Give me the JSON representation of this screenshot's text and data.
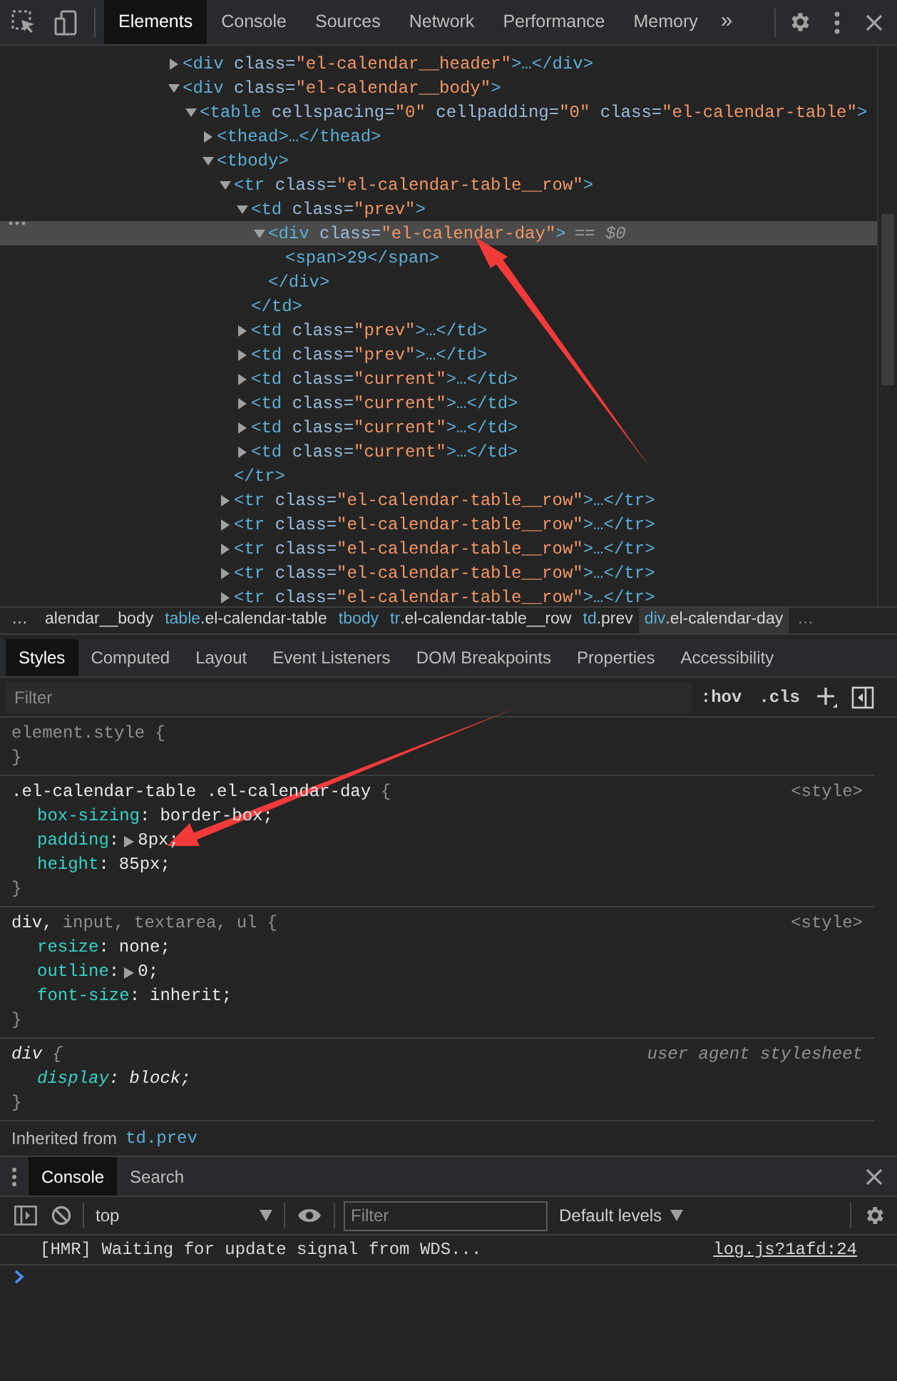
{
  "main_tabs": [
    {
      "label": "Elements",
      "selected": true
    },
    {
      "label": "Console",
      "selected": false
    },
    {
      "label": "Sources",
      "selected": false
    },
    {
      "label": "Network",
      "selected": false
    },
    {
      "label": "Performance",
      "selected": false
    },
    {
      "label": "Memory",
      "selected": false
    }
  ],
  "more_tabs": "»",
  "dom_tree": [
    {
      "tag": "<div class=\"el-calendar__header\">…</div>",
      "expanded": false,
      "selected": false
    },
    {
      "tag": "<div class=\"el-calendar__body\">",
      "expanded": true,
      "selected": false,
      "children": [
        {
          "tag": "<table cellspacing=\"0\" cellpadding=\"0\" class=\"el-calendar-table\">",
          "expanded": true,
          "selected": false,
          "children": [
            {
              "tag": "<thead>…</thead>",
              "expanded": false,
              "selected": false
            },
            {
              "tag": "<tbody>",
              "expanded": true,
              "selected": false,
              "children": [
                {
                  "tag": "<tr class=\"el-calendar-table__row\">",
                  "expanded": true,
                  "selected": false,
                  "close": "</tr>",
                  "children": [
                    {
                      "tag": "<td class=\"prev\">",
                      "expanded": true,
                      "selected": false,
                      "close": "</td>",
                      "children": [
                        {
                          "tag": "<div class=\"el-calendar-day\">",
                          "expanded": true,
                          "selected": true,
                          "suffix": "== $0",
                          "close": "</div>",
                          "children": [
                            {
                              "tag": "<span>29</span>",
                              "selected": false
                            }
                          ]
                        }
                      ]
                    },
                    {
                      "tag": "<td class=\"prev\">…</td>",
                      "expanded": false,
                      "selected": false
                    },
                    {
                      "tag": "<td class=\"prev\">…</td>",
                      "expanded": false,
                      "selected": false
                    },
                    {
                      "tag": "<td class=\"current\">…</td>",
                      "expanded": false,
                      "selected": false
                    },
                    {
                      "tag": "<td class=\"current\">…</td>",
                      "expanded": false,
                      "selected": false
                    },
                    {
                      "tag": "<td class=\"current\">…</td>",
                      "expanded": false,
                      "selected": false
                    },
                    {
                      "tag": "<td class=\"current\">…</td>",
                      "expanded": false,
                      "selected": false
                    }
                  ]
                },
                {
                  "tag": "<tr class=\"el-calendar-table__row\">…</tr>",
                  "expanded": false,
                  "selected": false
                },
                {
                  "tag": "<tr class=\"el-calendar-table__row\">…</tr>",
                  "expanded": false,
                  "selected": false
                },
                {
                  "tag": "<tr class=\"el-calendar-table__row\">…</tr>",
                  "expanded": false,
                  "selected": false
                },
                {
                  "tag": "<tr class=\"el-calendar-table__row\">…</tr>",
                  "expanded": false,
                  "selected": false
                },
                {
                  "tag": "<tr class=\"el-calendar-table__row\">…</tr>",
                  "expanded": false,
                  "selected": false
                }
              ]
            }
          ]
        }
      ]
    }
  ],
  "breadcrumbs": {
    "more": "…",
    "items": [
      {
        "cls": "alendar__body",
        "selected": false
      },
      {
        "tag": "table",
        "cls": ".el-calendar-table",
        "selected": false
      },
      {
        "tag": "tbody",
        "selected": false
      },
      {
        "tag": "tr",
        "cls": ".el-calendar-table__row",
        "selected": false
      },
      {
        "tag": "td",
        "cls": ".prev",
        "selected": false
      },
      {
        "tag": "div",
        "cls": ".el-calendar-day",
        "selected": true
      }
    ]
  },
  "sidebar_tabs": [
    {
      "label": "Styles",
      "selected": true
    },
    {
      "label": "Computed",
      "selected": false
    },
    {
      "label": "Layout",
      "selected": false
    },
    {
      "label": "Event Listeners",
      "selected": false
    },
    {
      "label": "DOM Breakpoints",
      "selected": false
    },
    {
      "label": "Properties",
      "selected": false
    },
    {
      "label": "Accessibility",
      "selected": false
    }
  ],
  "styles_filter": {
    "placeholder": "Filter",
    "hov": ":hov",
    "cls": ".cls"
  },
  "rules": [
    {
      "kind": "inline",
      "selector": [
        {
          "text": "element.style",
          "matched": false
        }
      ],
      "open": "{",
      "close": "}"
    },
    {
      "kind": "author",
      "source": "<style>",
      "selector": [
        {
          "text": ".el-calendar-table .el-calendar-day",
          "matched": true
        }
      ],
      "open": "{",
      "close": "}",
      "declarations": [
        {
          "name": "box-sizing",
          "colon": ":",
          "value": "border-box;",
          "expandable": false
        },
        {
          "name": "padding",
          "colon": ":",
          "value": "8px;",
          "expandable": true
        },
        {
          "name": "height",
          "colon": ":",
          "value": "85px;",
          "expandable": false
        }
      ]
    },
    {
      "kind": "author",
      "source": "<style>",
      "selector": [
        {
          "text": "div,",
          "matched": true
        },
        {
          "text": "input,",
          "matched": false
        },
        {
          "text": "textarea,",
          "matched": false
        },
        {
          "text": "ul",
          "matched": false
        }
      ],
      "open": "{",
      "close": "}",
      "declarations": [
        {
          "name": "resize",
          "colon": ":",
          "value": "none;",
          "expandable": false
        },
        {
          "name": "outline",
          "colon": ":",
          "value": "0;",
          "expandable": true
        },
        {
          "name": "font-size",
          "colon": ":",
          "value": "inherit;",
          "expandable": false
        }
      ]
    },
    {
      "kind": "user-agent",
      "source": "user agent stylesheet",
      "selector": [
        {
          "text": "div",
          "matched": true
        }
      ],
      "open": "{",
      "close": "}",
      "declarations": [
        {
          "name": "display",
          "colon": ":",
          "value": "block;",
          "expandable": false
        }
      ]
    }
  ],
  "inherited": {
    "label": "Inherited from",
    "link": "td.prev"
  },
  "drawer_tabs": [
    {
      "label": "Console",
      "selected": true
    },
    {
      "label": "Search",
      "selected": false
    }
  ],
  "console_toolbar": {
    "context": "top",
    "filter_placeholder": "Filter",
    "levels": "Default levels"
  },
  "console_messages": [
    {
      "text": "[HMR] Waiting for update signal from WDS...",
      "source": "log.js?1afd:24"
    }
  ]
}
